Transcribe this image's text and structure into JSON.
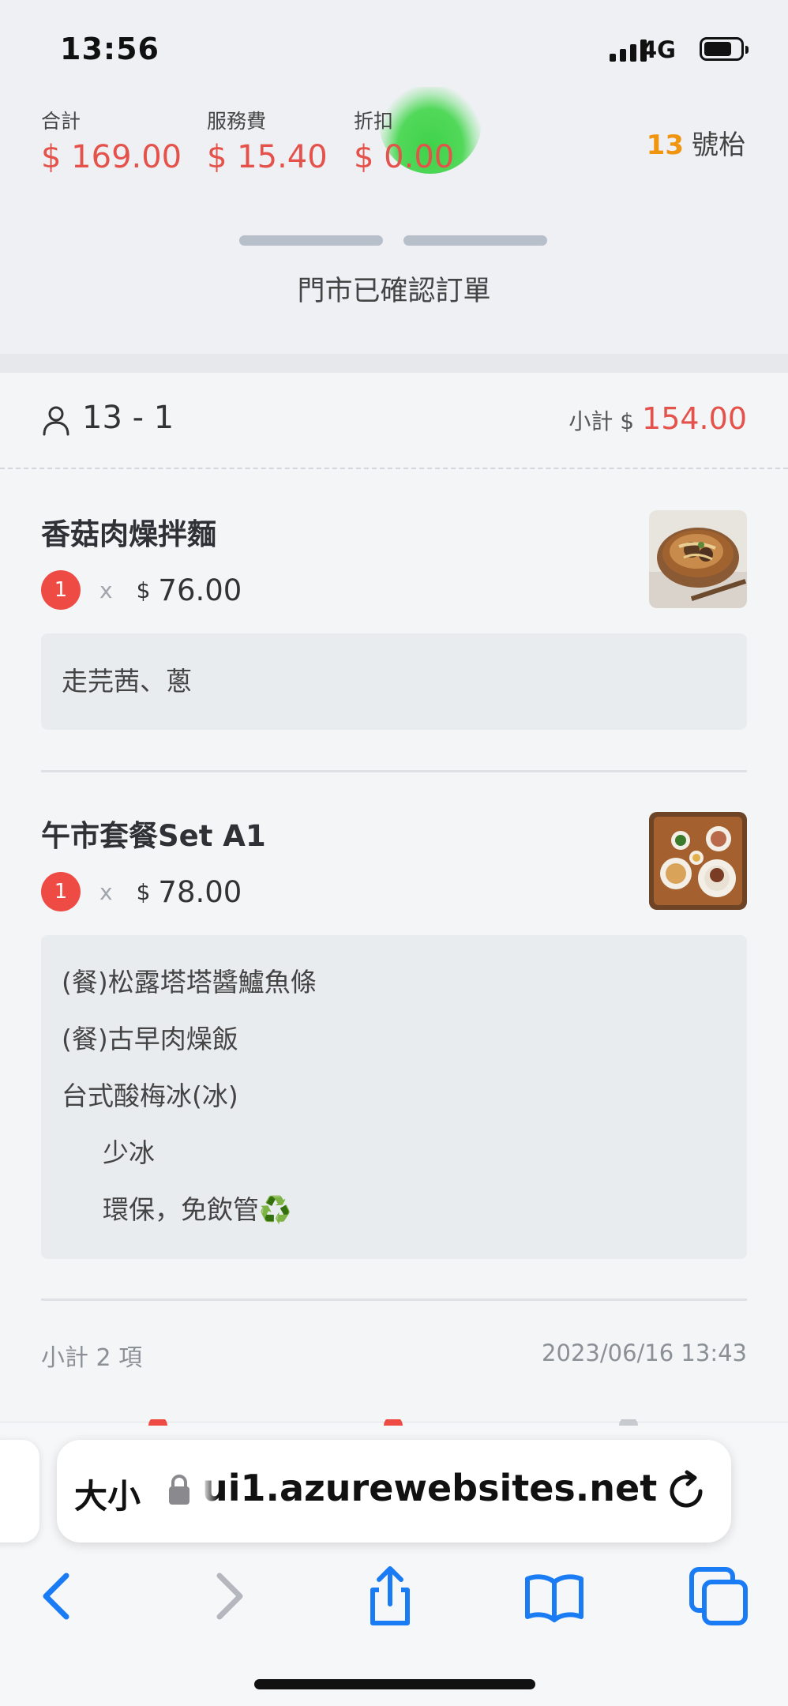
{
  "status_bar": {
    "time": "13:56",
    "network": "4G"
  },
  "summary": {
    "total_label": "合計",
    "total_value": "$ 169.00",
    "service_label": "服務費",
    "service_value": "$ 15.40",
    "discount_label": "折扣",
    "discount_value": "$ 0.00",
    "table_number": "13",
    "table_suffix": "號枱"
  },
  "order_status": "門市已確認訂單",
  "guest": {
    "label": "13 - 1",
    "subtotal_label": "小計 $",
    "subtotal_value": "154.00"
  },
  "items": [
    {
      "name": "香菇肉燥拌麵",
      "qty": "1",
      "times": "x",
      "currency": "$",
      "price": "76.00",
      "notes": [
        "走芫茜、蔥"
      ]
    },
    {
      "name": "午市套餐Set A1",
      "qty": "1",
      "times": "x",
      "currency": "$",
      "price": "78.00",
      "notes": [
        "(餐)松露塔塔醬鱸魚條",
        "(餐)古早肉燥飯",
        "台式酸梅冰(冰)",
        "少冰",
        "環保，免飲管♻️"
      ]
    }
  ],
  "footer": {
    "count_label": "小計 2 項",
    "timestamp": "2023/06/16 13:43"
  },
  "browser": {
    "text_size_label": "大小",
    "url": "ui1.azurewebsites.net",
    "toolbar_icons": [
      "back-icon",
      "forward-icon",
      "share-icon",
      "bookmarks-icon",
      "tabs-icon"
    ]
  },
  "colors": {
    "accent_red": "#e5524b",
    "table_orange": "#f0950f",
    "ios_blue": "#1a7cf5",
    "progress_green": "#3fd24a"
  }
}
